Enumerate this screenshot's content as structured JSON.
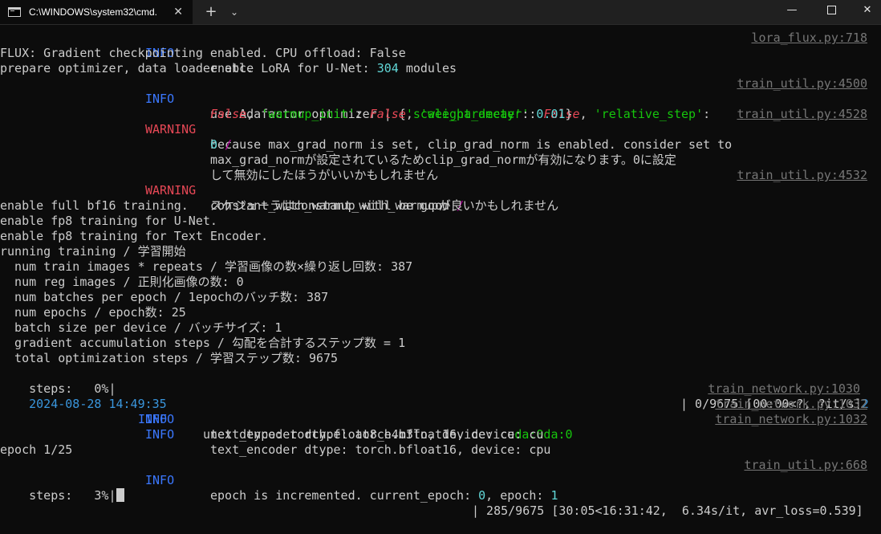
{
  "window": {
    "tab_title": "C:\\WINDOWS\\system32\\cmd.",
    "tab_close": "✕",
    "new_tab": "+",
    "dropdown": "⌄",
    "minimize": "—",
    "close": "✕"
  },
  "terminal": {
    "l1": {
      "lvl": "INFO",
      "msg": "enable LoRA for U-Net: ",
      "num": "304",
      "msg2": " modules",
      "src": "lora_flux.py:718"
    },
    "l2": "FLUX: Gradient checkpointing enabled. CPU offload: False",
    "l3": "prepare optimizer, data loader etc.",
    "l4": {
      "lvl": "INFO",
      "a": "use Adafactor optimizer | {",
      "k1": "'scale_parameter'",
      "c1": ": ",
      "v1": "False",
      "c2": ", ",
      "k2": "'relative_step'",
      "c3": ":",
      "src": "train_util.py:4500"
    },
    "l5": {
      "v1": "False",
      "c1": ", ",
      "k1": "'warmup_init'",
      "c2": ": ",
      "v2": "False",
      "c3": ", ",
      "k2": "'weight_decay'",
      "c4": ": ",
      "num": "0.01",
      "c5": "}"
    },
    "l6": {
      "lvl": "WARNING",
      "msg": "because max_grad_norm is set, clip_grad_norm is enabled. consider set to",
      "src": "train_util.py:4528"
    },
    "l7": {
      "num": "0",
      "slash": " /"
    },
    "l8": "max_grad_normが設定されているためclip_grad_normが有効になります。0に設定",
    "l9": "して無効にしたほうがいいかもしれません",
    "l10": {
      "lvl": "WARNING",
      "msg": "constant_with_warmup will be good ",
      "slash": "/",
      "src": "train_util.py:4532"
    },
    "l11": "スケジューラはconstant_with_warmupが良いかもしれません",
    "l12": "enable full bf16 training.",
    "l13": "enable fp8 training for U-Net.",
    "l14": "enable fp8 training for Text Encoder.",
    "l15": "running training / 学習開始",
    "l16": {
      "msg": "  num train images * repeats / 学習画像の数×繰り返し回数: ",
      "num": "387"
    },
    "l17": {
      "msg": "  num reg images / 正則化画像の数: ",
      "num": "0"
    },
    "l18": {
      "msg": "  num batches per epoch / 1epochのバッチ数: ",
      "num": "387"
    },
    "l19": {
      "msg": "  num epochs / epoch数: ",
      "num": "25"
    },
    "l20": {
      "msg": "  batch size per device / バッチサイズ: ",
      "num": "1"
    },
    "l21": {
      "msg": "  gradient accumulation steps / 勾配を合計するステップ数 = ",
      "num": "1"
    },
    "l22": {
      "msg": "  total optimization steps / 学習ステップ数: ",
      "num": "9675"
    },
    "l23": {
      "left": "steps:   0%|",
      "right": "| 0/9675 [00:00<?, ?it/s]",
      "tail": "2"
    },
    "l24": {
      "ts": "2024-08-28 14:49:35",
      "lvl": "INFO",
      "msg": "unet dtype: torch.float8_e4m3fn, device: cu",
      "hl": "da:0",
      "src": "train_network.py:1030"
    },
    "l25": {
      "lvl": "INFO",
      "msg": "text_encoder dtype: torch.bfloat16, device: cu",
      "hl": "da:0",
      "src": "train_network.py:1032"
    },
    "l26": {
      "lvl": "INFO",
      "msg": "text_encoder dtype: torch.bfloat16, device: cpu",
      "src": "train_network.py:1032"
    },
    "l27": "epoch 1/25",
    "l28": {
      "lvl": "INFO",
      "msg": "epoch is incremented. current_epoch: ",
      "n1": "0",
      "mid": ", epoch: ",
      "n2": "1",
      "src": "train_util.py:668"
    },
    "l29": {
      "left": "steps:   3%|",
      "right": "| 285/9675 [30:05<16:31:42,  6.34s/it, avr_loss=0.539]"
    }
  },
  "progress": {
    "current_steps": 285,
    "total_steps": 9675,
    "percent": 3
  },
  "colors": {
    "background": "#0c0c0c",
    "text": "#cccccc",
    "info": "#3b78ff",
    "warning": "#e74856",
    "number": "#61d6d6",
    "string": "#16c60c",
    "source_ref": "#767676"
  },
  "icons": [
    "terminal-icon",
    "close-icon",
    "plus-icon",
    "chevron-down-icon",
    "minimize-icon",
    "maximize-icon",
    "close-window-icon"
  ]
}
